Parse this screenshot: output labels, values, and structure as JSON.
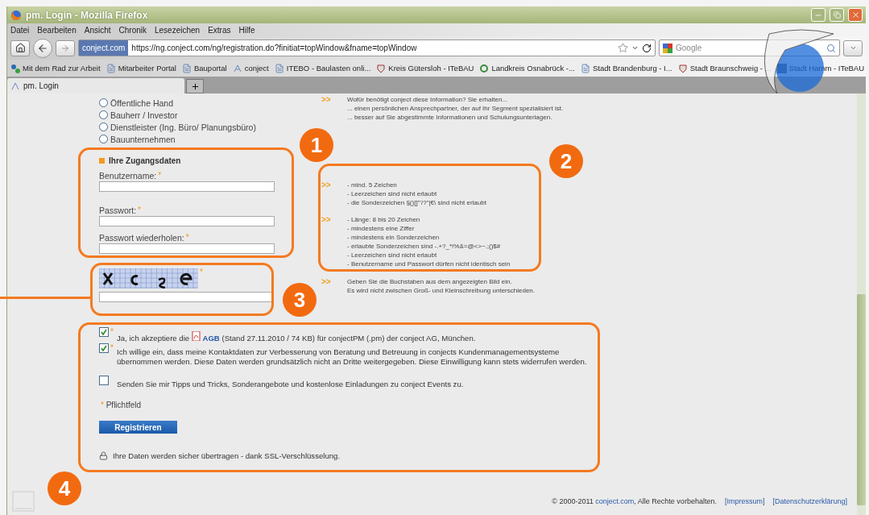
{
  "window": {
    "title": "pm. Login - Mozilla Firefox"
  },
  "menu": [
    "Datei",
    "Bearbeiten",
    "Ansicht",
    "Chronik",
    "Lesezeichen",
    "Extras",
    "Hilfe"
  ],
  "navbar": {
    "site_badge": "conject.com",
    "url": "https://ng.conject.com/ng/registration.do?finitiat=topWindow&fname=topWindow",
    "search_placeholder": "Google"
  },
  "bookmarks": [
    {
      "label": "Mit dem Rad zur Arbeit",
      "kind": "dots"
    },
    {
      "label": "Mitarbeiter Portal",
      "kind": "page"
    },
    {
      "label": "Bauportal",
      "kind": "page"
    },
    {
      "label": "conject",
      "kind": "logo"
    },
    {
      "label": "ITEBO - Baulasten onli...",
      "kind": "page"
    },
    {
      "label": "Kreis Gütersloh - ITeBAU",
      "kind": "crest"
    },
    {
      "label": "Landkreis Osnabrück -...",
      "kind": "ring"
    },
    {
      "label": "Stadt Brandenburg - I...",
      "kind": "page"
    },
    {
      "label": "Stadt Braunschweig - ...",
      "kind": "crest"
    },
    {
      "label": "Stadt Hamm - ITeBAU",
      "kind": "photo"
    }
  ],
  "tabs": [
    {
      "label": "pm. Login",
      "selected": true
    }
  ],
  "form": {
    "required_mark": "*",
    "segment_options": [
      {
        "label": "Öffentliche Hand",
        "selected": false
      },
      {
        "label": "Bauherr / Investor",
        "selected": false
      },
      {
        "label": "Dienstleister (Ing. Büro/ Planungsbüro)",
        "selected": false
      },
      {
        "label": "Bauunternehmen",
        "selected": false
      }
    ],
    "segment_info": {
      "marker": ">>",
      "lines": [
        "Wofür benötigt conject diese Information? Sie erhalten...",
        "... einen persönlichen Ansprechpartner, der auf Ihr Segment spezialisiert ist.",
        "... besser auf Sie abgestimmte Informationen und Schulungsunterlagen."
      ]
    },
    "credentials": {
      "heading": "Ihre Zugangsdaten",
      "fields": [
        {
          "label": "Benutzername:",
          "required": true
        },
        {
          "label": "Passwort:",
          "required": true
        },
        {
          "label": "Passwort wiederholen:",
          "required": true
        }
      ]
    },
    "rules": [
      {
        "marker": ">>",
        "lines": [
          "- mind. 5 Zeichen",
          "- Leerzeichen sind nicht erlaubt",
          "- die Sonderzeichen §()[]\"'/?\"|€\\ sind nicht erlaubt"
        ]
      },
      {
        "marker": ">>",
        "lines": [
          "- Länge: 8 bis 20 Zeichen",
          "- mindestens eine Ziffer",
          "- mindestens ein Sonderzeichen",
          "- erlaubte Sonderzeichen sind -.+?_*!%&=@<>~.;()$#",
          "- Leerzeichen sind nicht erlaubt",
          "- Benutzername und Passwort dürfen nicht identisch sein"
        ]
      }
    ],
    "captcha": {
      "required": true,
      "hint": {
        "marker": ">>",
        "lines": [
          "Geben Sie die Buchstaben aus dem angezeigten Bild ein.",
          "Es wird nicht zwischen Groß- und Kleinschreibung unterschieden."
        ]
      }
    },
    "consents": [
      {
        "checked": true,
        "required": true,
        "before": "Ja, ich akzeptiere die",
        "link": "AGB",
        "after": "(Stand 27.11.2010 / 74 KB) für conjectPM (.pm) der conject AG, München."
      },
      {
        "checked": true,
        "required": true,
        "before": "Ich willige ein, dass meine Kontaktdaten zur Verbesserung von Beratung und Betreuung in conjects Kundenmanagementsysteme übernommen werden. Diese Daten werden grundsätzlich nicht an Dritte weitergegeben. Diese Einwilligung kann stets widerrufen werden."
      },
      {
        "checked": false,
        "required": false,
        "before": "Senden Sie mir Tipps und Tricks, Sonderangebote und kostenlose Einladungen zu conject Events zu."
      }
    ],
    "required_note": "Pflichtfeld",
    "submit": "Registrieren",
    "ssl_note": "Ihre Daten werden sicher übertragen - dank SSL-Verschlüsselung."
  },
  "footer": {
    "copyright": "© 2000-2011",
    "link": "conject.com",
    "rest": ", Alle Rechte vorbehalten.",
    "links": [
      "[Impressum]",
      "[Datenschutzerklärung]"
    ]
  },
  "annotations": [
    {
      "number": "1"
    },
    {
      "number": "2"
    },
    {
      "number": "3"
    },
    {
      "number": "4"
    }
  ]
}
